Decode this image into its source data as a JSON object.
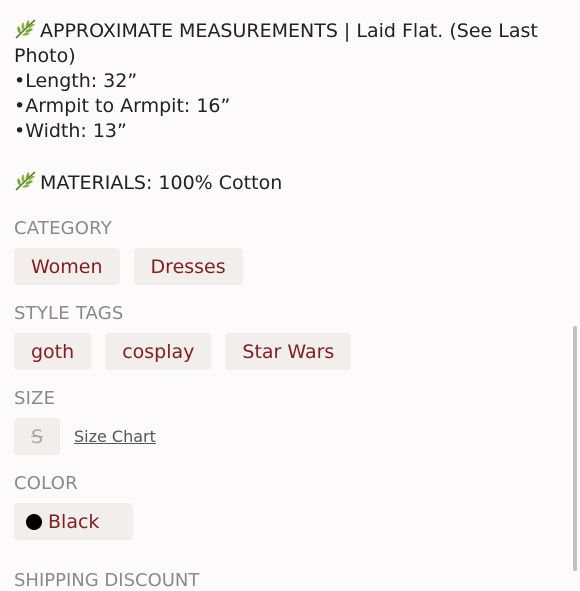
{
  "description": {
    "measurements_heading": "APPROXIMATE MEASUREMENTS | Laid Flat. (See Last Photo)",
    "length": "•Length: 32”",
    "armpit": "•Armpit to Armpit: 16”",
    "width": "•Width: 13”",
    "materials": "MATERIALS: 100% Cotton",
    "leaf_icon": "herb-leaf-icon"
  },
  "category": {
    "label": "CATEGORY",
    "items": [
      "Women",
      "Dresses"
    ]
  },
  "style_tags": {
    "label": "STYLE TAGS",
    "items": [
      "goth",
      "cosplay",
      "Star Wars"
    ]
  },
  "size": {
    "label": "SIZE",
    "value": "S",
    "chart_link": "Size Chart"
  },
  "color": {
    "label": "COLOR",
    "value": "Black",
    "swatch": "#000000"
  },
  "next_section": {
    "label": "SHIPPING DISCOUNT"
  },
  "colors": {
    "accent": "#7f1d24",
    "chip_bg": "#f1eeec",
    "label_gray": "#8a8a8a"
  }
}
